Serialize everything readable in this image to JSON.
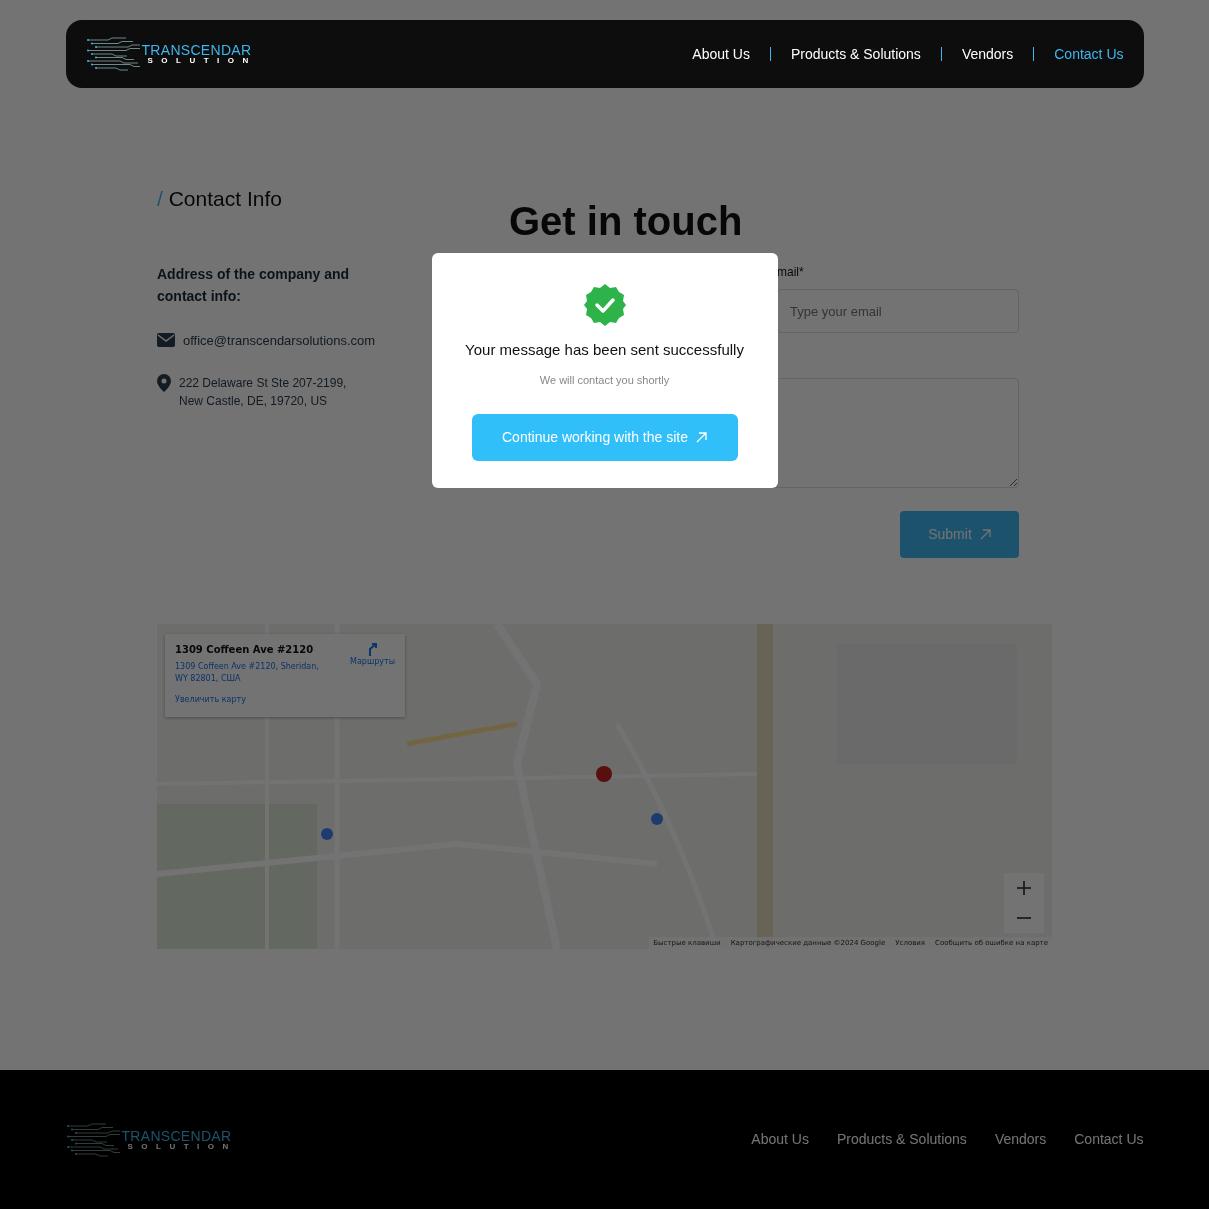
{
  "header": {
    "logo": {
      "top": "TRANSCENDAR",
      "bottom": "SOLUTION"
    },
    "nav": [
      {
        "label": "About Us",
        "selected": false
      },
      {
        "label": "Products & Solutions",
        "selected": false
      },
      {
        "label": "Vendors",
        "selected": false
      },
      {
        "label": "Contact Us",
        "selected": true
      }
    ]
  },
  "contact_info": {
    "heading_mark": "/",
    "heading": "Contact Info",
    "intro": "Address of the company and contact info:",
    "email": "office@transcendarsolutions.com",
    "address_lines": [
      "222 Delaware St Ste 207-2199,",
      "New Castle, DE, 19720, US"
    ]
  },
  "form": {
    "title": "Get in touch",
    "email_label": "mail*",
    "email_placeholder": "Type your email",
    "submit": "Submit"
  },
  "map": {
    "place_title": "1309 Coffeen Ave #2120",
    "place_address": "1309 Coffeen Ave #2120, Sheridan, WY 82801, США",
    "directions": "Маршруты",
    "enlarge": "Увеличить карту",
    "attribution": [
      "Быстрые клавиши",
      "Картографические данные ©2024 Google",
      "Условия",
      "Сообщить об ошибке на карте"
    ]
  },
  "modal": {
    "title": "Your message has been sent successfully",
    "subtitle": "We will contact you shortly",
    "button": "Continue working with the site"
  },
  "footer": {
    "logo": {
      "top": "TRANSCENDAR",
      "bottom": "SOLUTION"
    },
    "nav": [
      {
        "label": "About Us"
      },
      {
        "label": "Products & Solutions"
      },
      {
        "label": "Vendors"
      },
      {
        "label": "Contact Us"
      }
    ]
  }
}
